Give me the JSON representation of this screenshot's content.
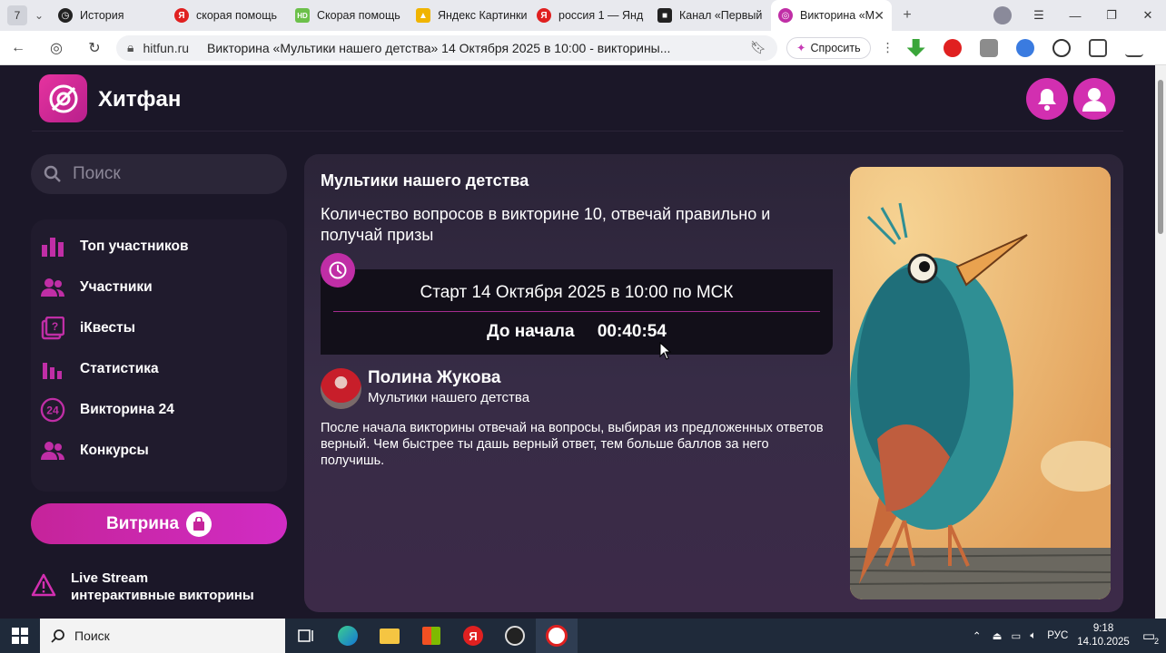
{
  "browser": {
    "tab_count": "7",
    "tabs": [
      {
        "label": "История",
        "fav": "history-icon",
        "color": "#222222"
      },
      {
        "label": "скорая помощь",
        "fav": "yandex-icon",
        "color": "#e02020"
      },
      {
        "label": "Скорая помощь",
        "fav": "hd-icon",
        "color": "#6cc04a"
      },
      {
        "label": "Яндекс Картинки",
        "fav": "images-icon",
        "color": "#f0b400"
      },
      {
        "label": "россия 1 — Янд",
        "fav": "yandex-icon",
        "color": "#e02020"
      },
      {
        "label": "Канал «Первый",
        "fav": "channel-icon",
        "color": "#222222"
      },
      {
        "label": "Викторина «Му",
        "fav": "hitfun-icon",
        "color": "#c02ea6",
        "active": true
      }
    ],
    "domain": "hitfun.ru",
    "page_title": "Викторина «Мультики нашего детства» 14 Октября 2025 в 10:00 - викторины...",
    "ask_label": "Спросить"
  },
  "site": {
    "brand": "Хитфан",
    "search_placeholder": "Поиск",
    "menu": [
      {
        "label": "Топ участников",
        "icon": "chart-bars-icon"
      },
      {
        "label": "Участники",
        "icon": "people-icon"
      },
      {
        "label": "iКвесты",
        "icon": "quest-icon"
      },
      {
        "label": "Статистика",
        "icon": "stats-icon"
      },
      {
        "label": "Викторина 24",
        "icon": "quiz24-icon",
        "badge": "24"
      },
      {
        "label": "Конкурсы",
        "icon": "contest-icon"
      }
    ],
    "vitrina_label": "Витрина",
    "live_line1": "Live Stream",
    "live_line2": "интерактивные викторины",
    "accent": "#d22fb0"
  },
  "quiz": {
    "title": "Мультики нашего детства",
    "description": "Количество вопросов в викторине 10, отвечай правильно и получай призы",
    "start": "Старт 14 Октября 2025 в 10:00 по МСК",
    "until_label": "До начала",
    "countdown": "00:40:54",
    "author_name": "Полина Жукова",
    "author_sub": "Мультики нашего детства",
    "body": "После начала викторины отвечай на вопросы, выбирая из предложенных ответов верный. Чем быстрее ты дашь верный ответ, тем больше баллов за него получишь."
  },
  "taskbar": {
    "search_label": "Поиск",
    "lang": "РУС",
    "time": "9:18",
    "date": "14.10.2025",
    "notifications": "2"
  }
}
